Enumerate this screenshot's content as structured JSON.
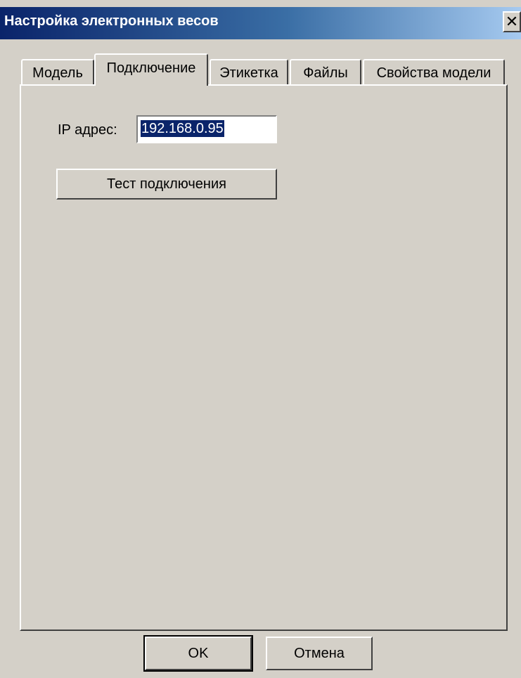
{
  "window": {
    "title": "Настройка электронных весов",
    "close_glyph": "✕"
  },
  "tabs": [
    {
      "label": "Модель",
      "active": false
    },
    {
      "label": "Подключение",
      "active": true
    },
    {
      "label": "Этикетка",
      "active": false
    },
    {
      "label": "Файлы",
      "active": false
    },
    {
      "label": "Свойства модели",
      "active": false
    }
  ],
  "connection": {
    "ip_label": "IP адрес:",
    "ip_value": "192.168.0.95",
    "test_button_label": "Тест подключения"
  },
  "footer": {
    "ok_label": "OK",
    "cancel_label": "Отмена"
  },
  "colors": {
    "face": "#d4d0c8",
    "title_start": "#0a246a",
    "title_end": "#a6caf0",
    "selection": "#0a246a"
  }
}
